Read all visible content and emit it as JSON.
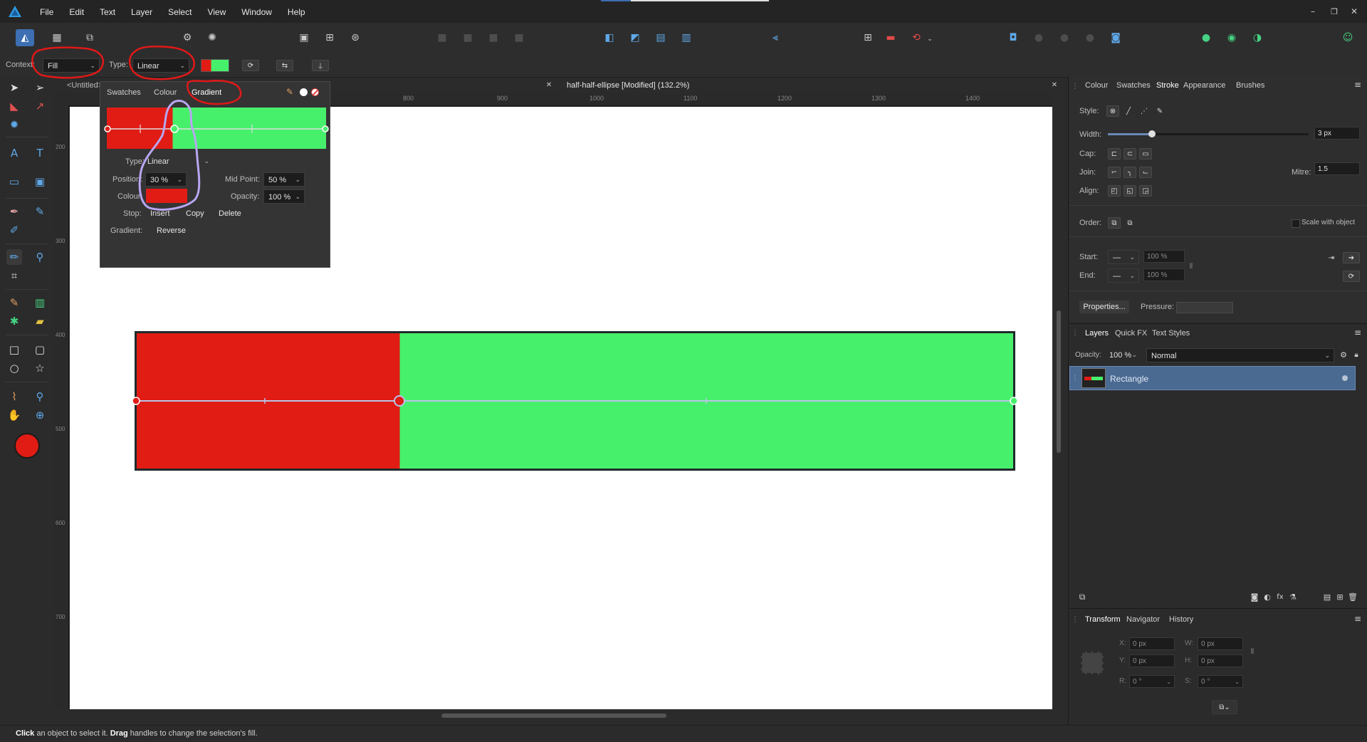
{
  "menu": [
    "File",
    "Edit",
    "Text",
    "Layer",
    "Select",
    "View",
    "Window",
    "Help"
  ],
  "window_controls": {
    "minimize": "–",
    "restore": "❐",
    "close": "✕"
  },
  "context_bar": {
    "context_label": "Context:",
    "context_value": "Fill",
    "type_label": "Type:",
    "type_value": "Linear"
  },
  "doc_tabs": {
    "untitled": "<Untitled>",
    "active": "half-half-ellipse [Modified] (132.2%)"
  },
  "ruler": {
    "top": [
      "800",
      "900",
      "1000",
      "1100",
      "1200",
      "1300",
      "1400"
    ],
    "left": [
      "200",
      "300",
      "400",
      "500",
      "600",
      "700"
    ]
  },
  "gradient_popup": {
    "tabs": [
      "Swatches",
      "Colour",
      "Gradient"
    ],
    "type_label": "Type:",
    "type_value": "Linear",
    "position_label": "Position:",
    "position_value": "30 %",
    "midpoint_label": "Mid Point:",
    "midpoint_value": "50 %",
    "colour_label": "Colour:",
    "opacity_label": "Opacity:",
    "opacity_value": "100 %",
    "stop_label": "Stop:",
    "insert": "Insert",
    "copy": "Copy",
    "delete": "Delete",
    "gradient_label": "Gradient:",
    "reverse": "Reverse"
  },
  "colors": {
    "red": "#e01c15",
    "green": "#47f06b",
    "annotation_red": "#e01818",
    "annotation_purple": "#b9a6f2",
    "accent": "#3d6fb2"
  },
  "stroke_panel": {
    "tabs": [
      "Colour",
      "Swatches",
      "Stroke",
      "Appearance",
      "Brushes"
    ],
    "style_label": "Style:",
    "width_label": "Width:",
    "width_value": "3 px",
    "width_fraction": 0.22,
    "cap_label": "Cap:",
    "join_label": "Join:",
    "mitre_label": "Mitre:",
    "mitre_value": "1.5",
    "align_label": "Align:",
    "order_label": "Order:",
    "scale_label": "Scale with object",
    "start_label": "Start:",
    "end_label": "End:",
    "start_pct": "100 %",
    "end_pct": "100 %",
    "properties_button": "Properties...",
    "pressure_label": "Pressure:"
  },
  "layers_panel": {
    "tabs": [
      "Layers",
      "Quick FX",
      "Text Styles"
    ],
    "opacity_label": "Opacity:",
    "opacity_value": "100 %",
    "blend_mode": "Normal",
    "layer_name": "Rectangle"
  },
  "transform_panel": {
    "tabs": [
      "Transform",
      "Navigator",
      "History"
    ],
    "x_label": "X:",
    "x_value": "0 px",
    "y_label": "Y:",
    "y_value": "0 px",
    "w_label": "W:",
    "w_value": "0 px",
    "h_label": "H:",
    "h_value": "0 px",
    "r_label": "R:",
    "r_value": "0 °",
    "s_label": "S:",
    "s_value": "0 °"
  },
  "status_bar": {
    "click": "Click",
    "t1": " an object to select it. ",
    "drag": "Drag",
    "t2": " handles to change the selection's fill."
  }
}
